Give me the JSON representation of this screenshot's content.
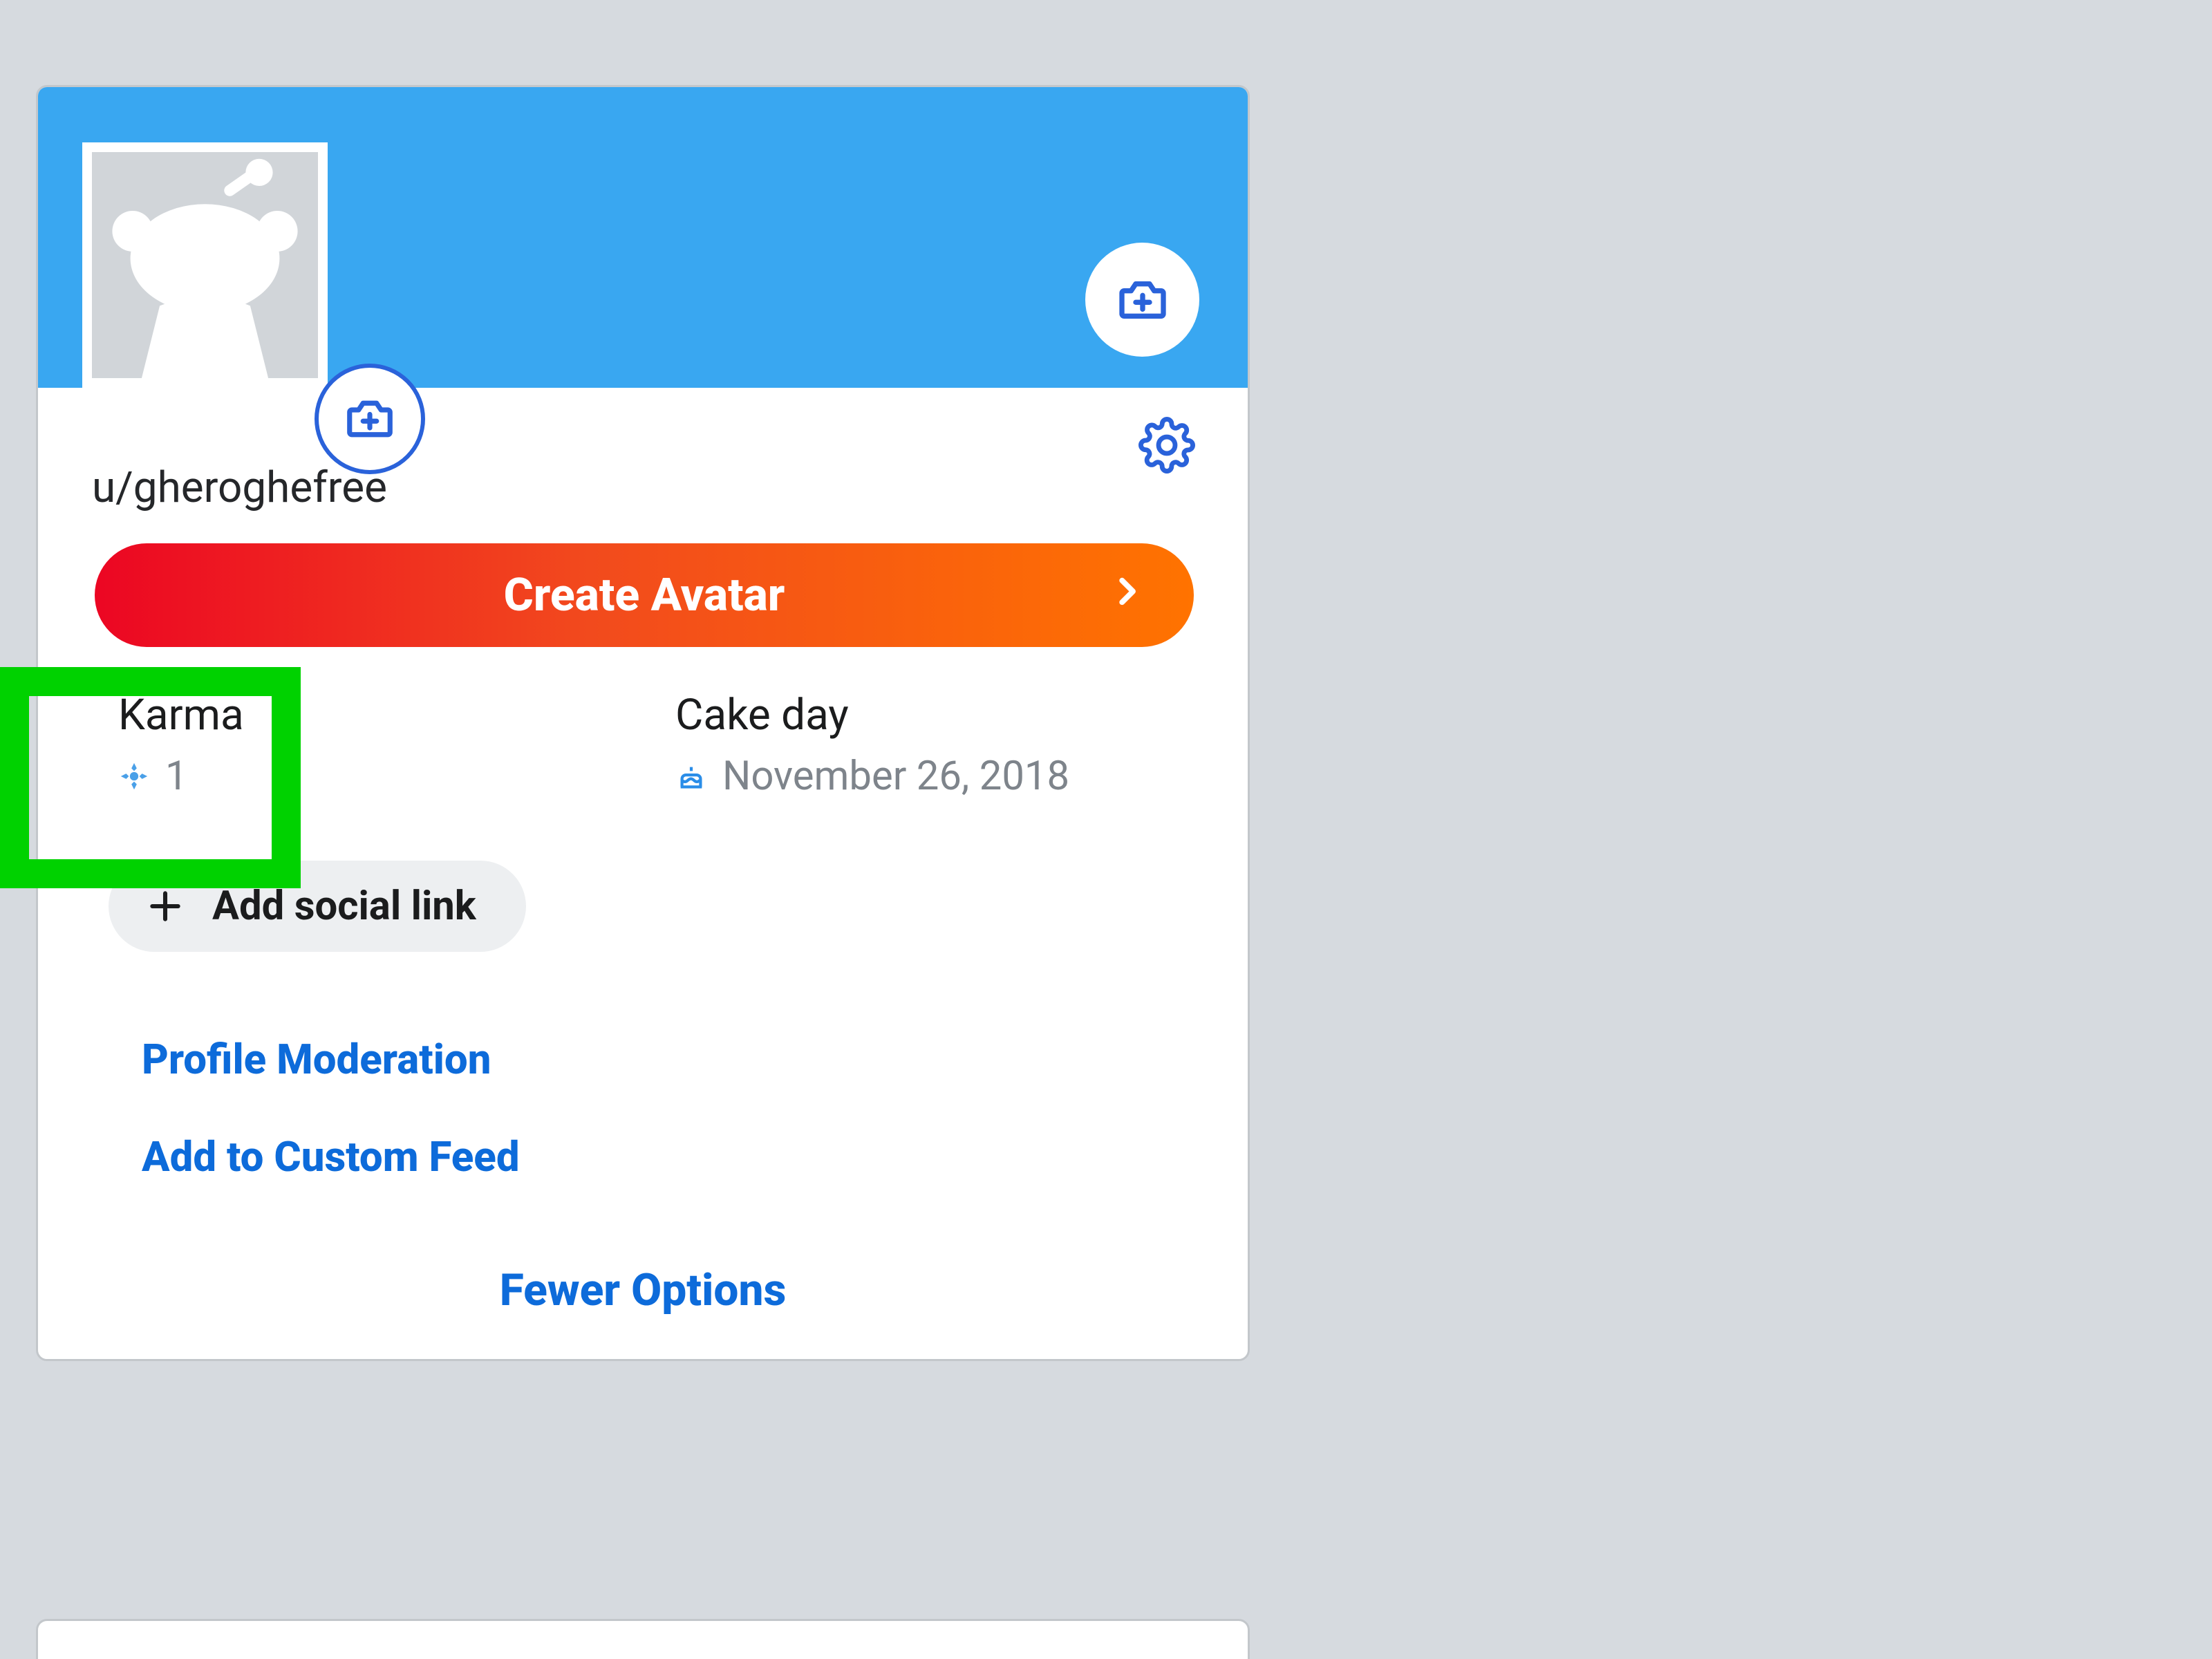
{
  "profile": {
    "username": "u/gheroghefree",
    "create_avatar_label": "Create Avatar",
    "karma_label": "Karma",
    "karma_value": "1",
    "cakeday_label": "Cake day",
    "cakeday_value": "November 26, 2018",
    "add_social_label": "Add social link",
    "profile_moderation_label": "Profile Moderation",
    "add_to_custom_feed_label": "Add to Custom Feed",
    "fewer_options_label": "Fewer Options"
  },
  "colors": {
    "accent_blue": "#39a7f1",
    "brand_blue": "#2a62da",
    "link_blue": "#0d6bda",
    "highlight_green": "#00d200",
    "gradient_start": "#ec0623",
    "gradient_end": "#ff7300"
  }
}
